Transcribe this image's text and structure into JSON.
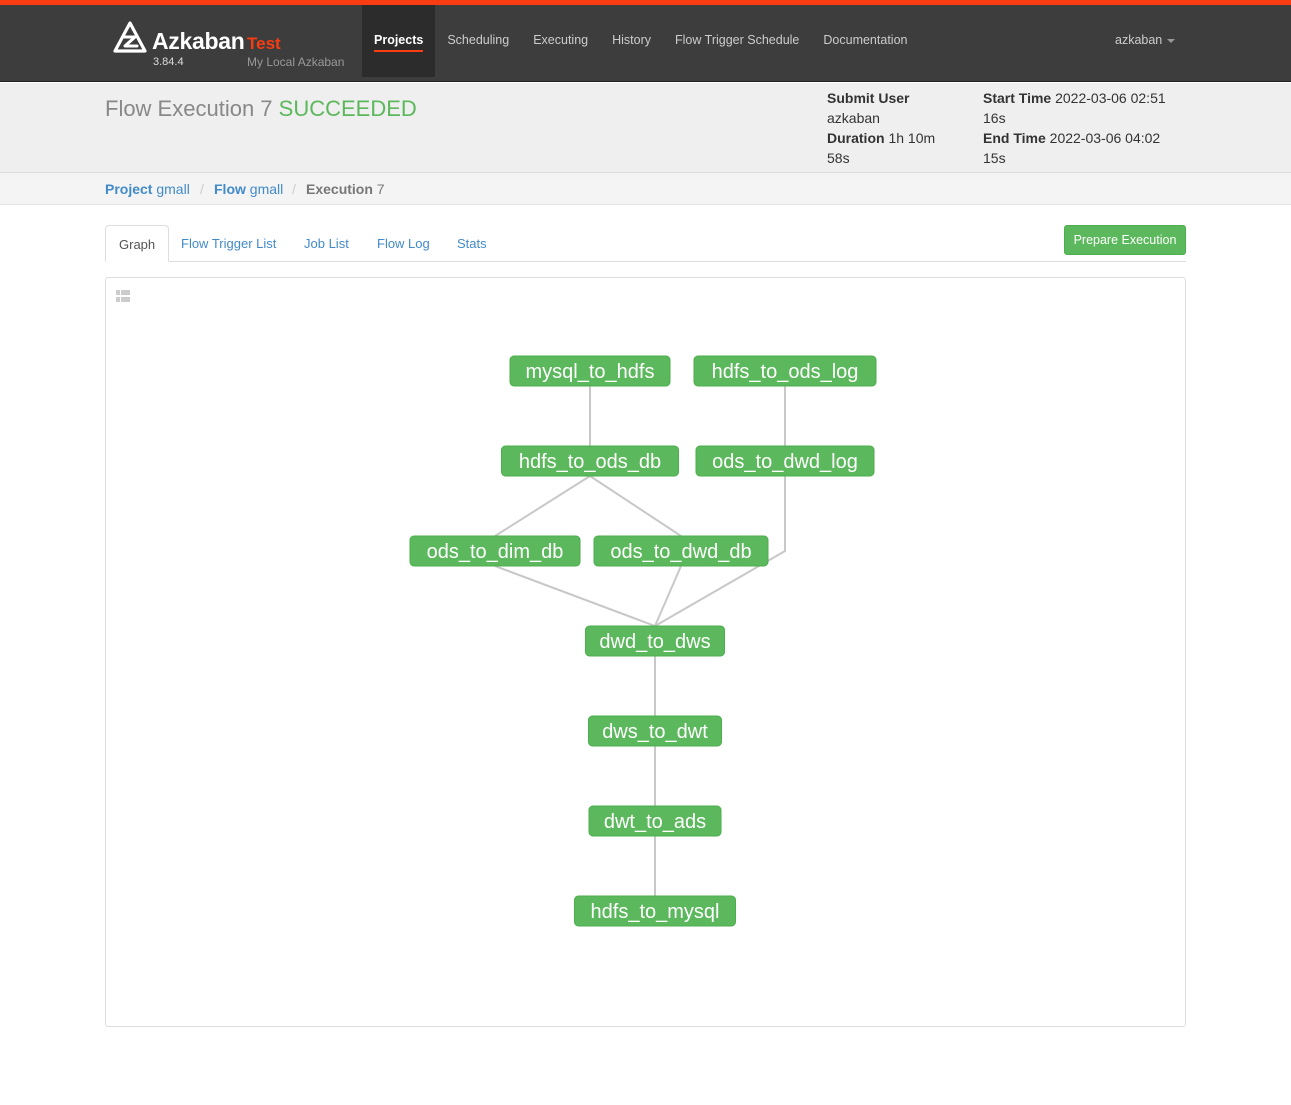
{
  "brand": {
    "name": "Azkaban",
    "environment": "Test",
    "version": "3.84.4",
    "subtitle": "My Local Azkaban"
  },
  "nav": {
    "items": [
      {
        "label": "Projects",
        "active": true
      },
      {
        "label": "Scheduling",
        "active": false
      },
      {
        "label": "Executing",
        "active": false
      },
      {
        "label": "History",
        "active": false
      },
      {
        "label": "Flow Trigger Schedule",
        "active": false
      },
      {
        "label": "Documentation",
        "active": false
      }
    ],
    "user": "azkaban"
  },
  "execution": {
    "title": "Flow Execution 7",
    "status": "SUCCEEDED",
    "submit_user_label": "Submit User",
    "submit_user": "azkaban",
    "duration_label": "Duration",
    "duration": "1h 10m 58s",
    "start_time_label": "Start Time",
    "start_time": "2022-03-06 02:51 16s",
    "end_time_label": "End Time",
    "end_time": "2022-03-06 04:02 15s"
  },
  "breadcrumb": {
    "project_label": "Project",
    "project": "gmall",
    "flow_label": "Flow",
    "flow": "gmall",
    "execution_label": "Execution",
    "execution": "7"
  },
  "tabs": [
    {
      "label": "Graph",
      "active": true
    },
    {
      "label": "Flow Trigger List",
      "active": false
    },
    {
      "label": "Job List",
      "active": false
    },
    {
      "label": "Flow Log",
      "active": false
    },
    {
      "label": "Stats",
      "active": false
    }
  ],
  "prepare_button": "Prepare Execution",
  "colors": {
    "accent": "#f93c11",
    "success": "#5cb85c",
    "link": "#428bca",
    "navbar": "#3d3d3d"
  },
  "graph": {
    "nodes": [
      {
        "id": "mysql_to_hdfs",
        "label": "mysql_to_hdfs",
        "status": "SUCCEEDED"
      },
      {
        "id": "hdfs_to_ods_log",
        "label": "hdfs_to_ods_log",
        "status": "SUCCEEDED"
      },
      {
        "id": "hdfs_to_ods_db",
        "label": "hdfs_to_ods_db",
        "status": "SUCCEEDED"
      },
      {
        "id": "ods_to_dwd_log",
        "label": "ods_to_dwd_log",
        "status": "SUCCEEDED"
      },
      {
        "id": "ods_to_dim_db",
        "label": "ods_to_dim_db",
        "status": "SUCCEEDED"
      },
      {
        "id": "ods_to_dwd_db",
        "label": "ods_to_dwd_db",
        "status": "SUCCEEDED"
      },
      {
        "id": "dwd_to_dws",
        "label": "dwd_to_dws",
        "status": "SUCCEEDED"
      },
      {
        "id": "dws_to_dwt",
        "label": "dws_to_dwt",
        "status": "SUCCEEDED"
      },
      {
        "id": "dwt_to_ads",
        "label": "dwt_to_ads",
        "status": "SUCCEEDED"
      },
      {
        "id": "hdfs_to_mysql",
        "label": "hdfs_to_mysql",
        "status": "SUCCEEDED"
      }
    ],
    "edges": [
      [
        "mysql_to_hdfs",
        "hdfs_to_ods_db"
      ],
      [
        "hdfs_to_ods_log",
        "ods_to_dwd_log"
      ],
      [
        "hdfs_to_ods_db",
        "ods_to_dim_db"
      ],
      [
        "hdfs_to_ods_db",
        "ods_to_dwd_db"
      ],
      [
        "ods_to_dim_db",
        "dwd_to_dws"
      ],
      [
        "ods_to_dwd_db",
        "dwd_to_dws"
      ],
      [
        "ods_to_dwd_log",
        "dwd_to_dws"
      ],
      [
        "dwd_to_dws",
        "dws_to_dwt"
      ],
      [
        "dws_to_dwt",
        "dwt_to_ads"
      ],
      [
        "dwt_to_ads",
        "hdfs_to_mysql"
      ]
    ]
  }
}
